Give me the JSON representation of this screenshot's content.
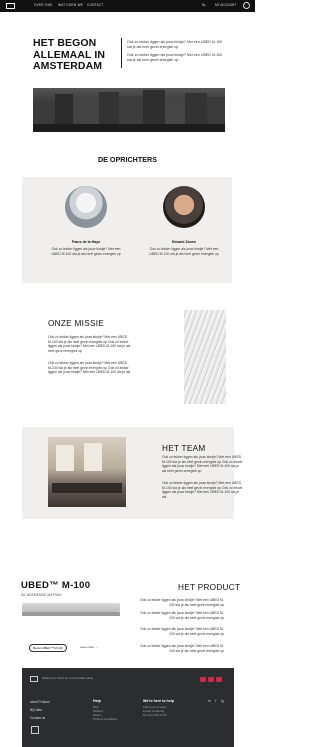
{
  "nav": {
    "links": [
      "OVER ONS",
      "WAT DOEN WE",
      "CONTACT"
    ],
    "language": "NL",
    "account": "MY ACCOUNT"
  },
  "hero": {
    "title_lines": [
      "HET BEGON",
      "ALLEMAAL IN",
      "AMSTERDAM"
    ],
    "paragraphs": [
      "Ook zo lekker liggen als jouw kindje? Met een UBED M-100 sta je als heel gezin energiek op",
      "Ook zo lekker liggen als jouw kindje? Met een UBED M-100 sta je als heel gezin energiek op"
    ]
  },
  "founders": {
    "title": "DE OPRICHTERS",
    "people": [
      {
        "name": "Frans de la Haye",
        "text": "Ook zo lekker liggen als jouw kindje? Met een UBED M-100 sta je als heel gezin energiek op"
      },
      {
        "name": "Eduard Zanen",
        "text": "Ook zo lekker liggen als jouw kindje? Met een UBED M-100 sta je als heel gezin energiek op"
      }
    ]
  },
  "mission": {
    "title": "ONZE MISSIE",
    "paragraphs": [
      "Ook zo lekker liggen als jouw kindje? Met een UBED M-100 sta je als heel gezin energiek op Ook zo lekker liggen als jouw kindje? Met een UBED M-100 sta je als heel gezin energiek op",
      "Ook zo lekker liggen als jouw kindje? Met een UBED M-100 sta je als heel gezin energiek op Ook zo lekker liggen als jouw kindje? Met een UBED M-100 sta je als"
    ]
  },
  "team": {
    "title": "HET TEAM",
    "paragraphs": [
      "Ook zo lekker liggen als jouw kindje? Met een UBED M-100 sta je als heel gezin energiek op Ook zo lekker liggen als jouw kindje? Met een UBED M-100 sta je als heel gezin energiek op",
      "Ook zo lekker liggen als jouw kindje? Met een UBED M-100 sta je als heel gezin energiek op Ook zo lekker liggen als jouw kindje? Met een UBED M-100 sta je als"
    ]
  },
  "product": {
    "brand": "UBED™ M-100",
    "brand_sub": "DE ADEMENDE MATRAS",
    "title": "HET PRODUCT",
    "paragraphs": [
      "Ook zo lekker liggen als jouw kindje? Met een UBED M-100 sta je als heel gezin energiek op",
      "Ook zo lekker liggen als jouw kindje? Met een UBED M-100 sta je als heel gezin energiek op",
      "Ook zo lekker liggen als jouw kindje? Met een UBED M-100 sta je als heel gezin energiek op",
      "Ook zo lekker liggen als jouw kindje? Met een UBED M-100 sta je als heel gezin energiek op"
    ],
    "cta_primary": "Bestel UBED™ M-100",
    "cta_secondary": "Lees meer →"
  },
  "footer": {
    "tagline": "Mattress by Ubed for a comfortable sleep",
    "col1": [
      "Ubed Product",
      "Bij Ubed",
      "Contact us"
    ],
    "col2_head": "Help",
    "col2": [
      "FAQ",
      "Delivery",
      "Return",
      "Terms & Conditions"
    ],
    "col3_head": "We're here to help",
    "col3": [
      "Call us at our team",
      "E-mail us directly",
      "Mon-Fri 9:00-17:00"
    ],
    "social": [
      "in",
      "f",
      "ig"
    ]
  }
}
